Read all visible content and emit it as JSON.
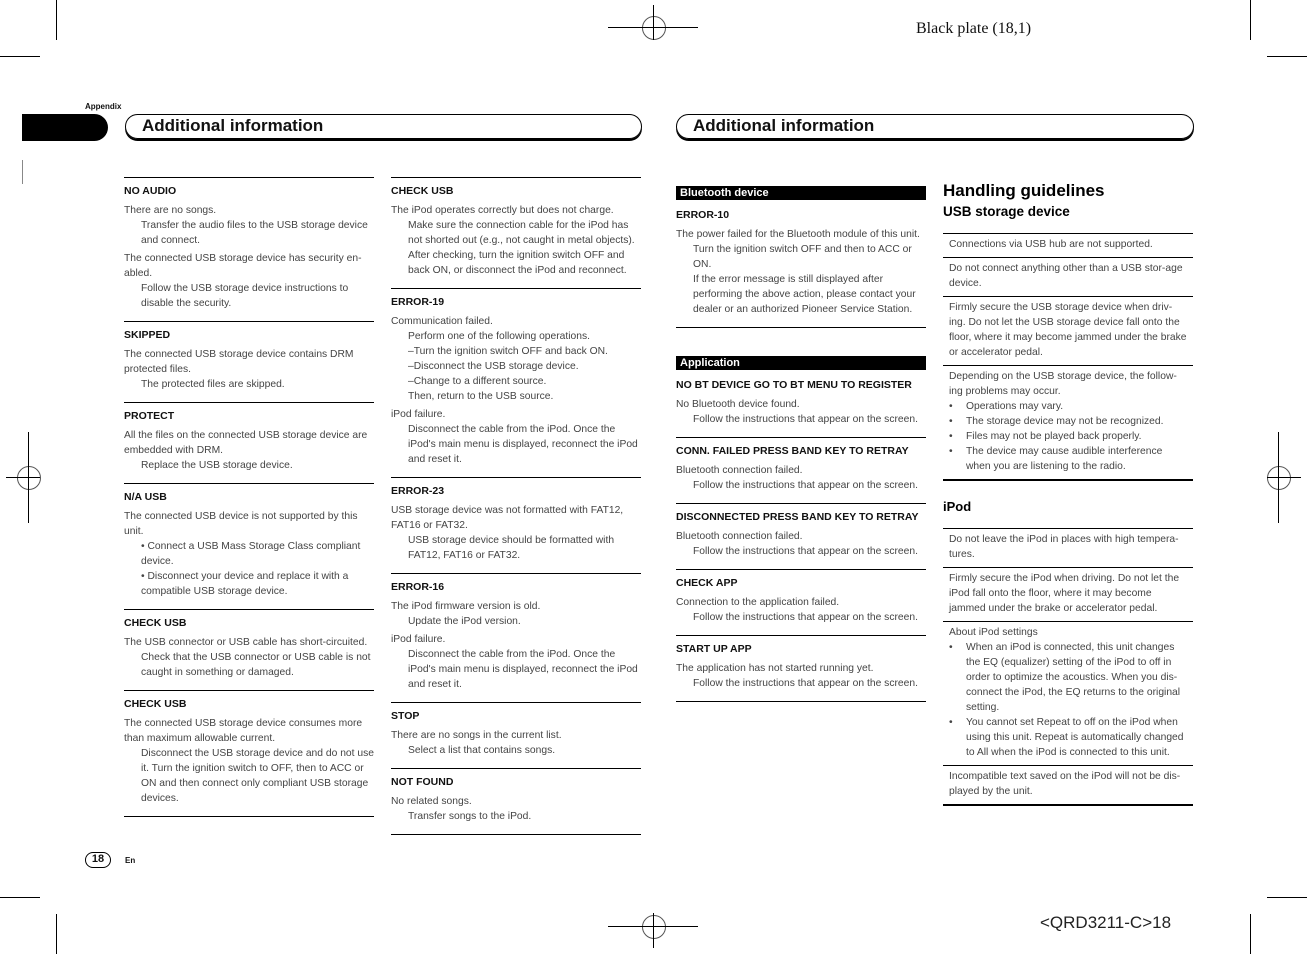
{
  "header": {
    "plate_label": "Black plate (18,1)",
    "appendix_label": "Appendix",
    "section_title_left": "Additional information",
    "section_title_right": "Additional information"
  },
  "footer": {
    "page_number": "18",
    "language": "En",
    "doc_code": "<QRD3211-C>18"
  },
  "column1": {
    "entries": [
      {
        "title": "NO AUDIO",
        "items": [
          {
            "cause": "There are no songs.",
            "fix": "Transfer the audio files to the USB storage device and connect."
          },
          {
            "cause": "The connected USB storage device has security en-abled.",
            "fix": "Follow the USB storage device instructions to disable the security."
          }
        ]
      },
      {
        "title": "SKIPPED",
        "items": [
          {
            "cause": "The connected USB storage device contains DRM protected files.",
            "fix": "The protected files are skipped."
          }
        ]
      },
      {
        "title": "PROTECT",
        "items": [
          {
            "cause": "All the files on the connected USB storage device are embedded with DRM.",
            "fix": "Replace the USB storage device."
          }
        ]
      },
      {
        "title": "N/A USB",
        "items": [
          {
            "cause": "The connected USB device is not supported by this unit.",
            "fix": "• Connect a USB Mass Storage Class compliant device.",
            "fix2": "• Disconnect your device and replace it with a compatible USB storage device."
          }
        ]
      },
      {
        "title": "CHECK USB",
        "items": [
          {
            "cause": "The USB connector or USB cable has short-circuited.",
            "fix": "Check that the USB connector or USB cable is not caught in something or damaged."
          }
        ]
      },
      {
        "title": "CHECK USB",
        "items": [
          {
            "cause": "The connected USB storage device consumes more than maximum allowable current.",
            "fix": "Disconnect the USB storage device and do not use it. Turn the ignition switch to OFF, then to ACC or ON and then connect only compliant USB storage devices."
          }
        ]
      }
    ]
  },
  "column2": {
    "entries": [
      {
        "title": "CHECK USB",
        "items": [
          {
            "cause": "The iPod operates correctly but does not charge.",
            "fix": "Make sure the connection cable for the iPod has not shorted out (e.g., not caught in metal objects). After checking, turn the ignition switch OFF and back ON, or disconnect the iPod and reconnect."
          }
        ]
      },
      {
        "title": "ERROR-19",
        "items": [
          {
            "cause": "Communication failed.",
            "fix": "Perform one of the following operations.",
            "fix_lines": [
              "–Turn the ignition switch OFF and back ON.",
              "–Disconnect the USB storage device.",
              "–Change to a different source.",
              "Then, return to the USB source."
            ]
          },
          {
            "cause": "iPod failure.",
            "fix": "Disconnect the cable from the iPod. Once the iPod's main menu is displayed, reconnect the iPod and reset it."
          }
        ]
      },
      {
        "title": "ERROR-23",
        "items": [
          {
            "cause": "USB storage device was not formatted with FAT12, FAT16 or FAT32.",
            "fix": "USB storage device should be formatted with FAT12, FAT16 or FAT32."
          }
        ]
      },
      {
        "title": "ERROR-16",
        "items": [
          {
            "cause": "The iPod firmware version is old.",
            "fix": "Update the iPod version."
          },
          {
            "cause": "iPod failure.",
            "fix": "Disconnect the cable from the iPod. Once the iPod's main menu is displayed, reconnect the iPod and reset it."
          }
        ]
      },
      {
        "title": "STOP",
        "items": [
          {
            "cause": "There are no songs in the current list.",
            "fix": "Select a list that contains songs."
          }
        ]
      },
      {
        "title": "NOT FOUND",
        "items": [
          {
            "cause": "No related songs.",
            "fix": "Transfer songs to the iPod."
          }
        ]
      }
    ]
  },
  "column3": {
    "bluetooth_band": "Bluetooth device",
    "bluetooth_entries": [
      {
        "title": "ERROR-10",
        "items": [
          {
            "cause": "The power failed for the Bluetooth module of this unit.",
            "fix": "Turn the ignition switch OFF and then to ACC or ON.",
            "fix2": "If the error message is still displayed after performing the above action, please contact your dealer or an authorized Pioneer Service Station."
          }
        ]
      }
    ],
    "application_band": "Application",
    "application_entries": [
      {
        "title": "NO BT DEVICE GO TO BT MENU TO REGISTER",
        "items": [
          {
            "cause": "No Bluetooth device found.",
            "fix": "Follow the instructions that appear on the screen."
          }
        ]
      },
      {
        "title": "CONN. FAILED PRESS BAND KEY TO RETRAY",
        "items": [
          {
            "cause": "Bluetooth connection failed.",
            "fix": "Follow the instructions that appear on the screen."
          }
        ]
      },
      {
        "title": "DISCONNECTED PRESS BAND KEY TO RETRAY",
        "items": [
          {
            "cause": "Bluetooth connection failed.",
            "fix": "Follow the instructions that appear on the screen."
          }
        ]
      },
      {
        "title": "CHECK APP",
        "items": [
          {
            "cause": "Connection to the application failed.",
            "fix": "Follow the instructions that appear on the screen."
          }
        ]
      },
      {
        "title": "START UP APP",
        "items": [
          {
            "cause": "The application has not started running yet.",
            "fix": "Follow the instructions that appear on the screen."
          }
        ]
      }
    ]
  },
  "column4": {
    "heading": "Handling guidelines",
    "usb_heading": "USB storage device",
    "usb_items": [
      {
        "text": "Connections via USB hub are not supported."
      },
      {
        "text": "Do not connect anything other than a USB stor-age device."
      },
      {
        "text": "Firmly secure the USB storage device when driv-ing. Do not let the USB storage device fall onto the floor, where it may become jammed under the brake or accelerator pedal."
      },
      {
        "text": "Depending on the USB storage device, the follow-ing problems may occur.",
        "bullets": [
          "Operations may vary.",
          "The storage device may not be recognized.",
          "Files may not be played back properly.",
          "The device may cause audible interference when you are listening to the radio."
        ]
      }
    ],
    "ipod_heading": "iPod",
    "ipod_items": [
      {
        "text": "Do not leave the iPod in places with high tempera-tures."
      },
      {
        "text": "Firmly secure the iPod when driving. Do not let the iPod fall onto the floor, where it may become jammed under the brake or accelerator pedal."
      },
      {
        "text": "About iPod settings",
        "bullets": [
          "When an iPod is connected, this unit changes the EQ (equalizer) setting of the iPod to off in order to optimize the acoustics. When you dis-connect the iPod, the EQ returns to the original setting.",
          "You cannot set Repeat to off on the iPod when using this unit. Repeat is automatically changed to All when the iPod is connected to this unit."
        ]
      },
      {
        "text": "Incompatible text saved on the iPod will not be dis-played by the unit."
      }
    ]
  }
}
